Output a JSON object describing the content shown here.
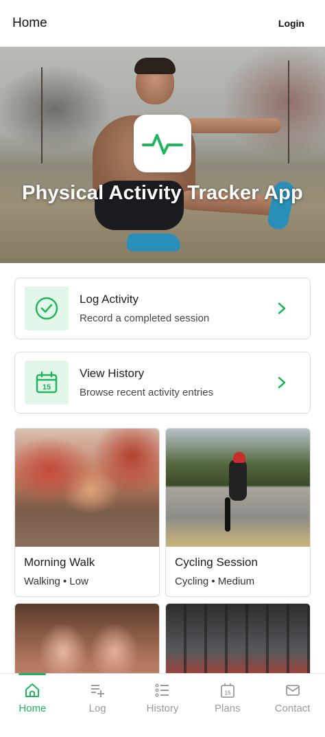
{
  "header": {
    "title": "Home",
    "login_label": "Login"
  },
  "hero": {
    "title": "Physical Activity Tracker App",
    "logo_icon": "pulse-icon"
  },
  "actions": [
    {
      "title": "Log Activity",
      "subtitle": "Record a completed session",
      "icon": "check-circle-icon"
    },
    {
      "title": "View History",
      "subtitle": "Browse recent activity entries",
      "icon": "calendar-icon",
      "calendar_day": "15"
    }
  ],
  "activities": [
    {
      "name": "Morning Walk",
      "meta": "Walking • Low"
    },
    {
      "name": "Cycling Session",
      "meta": "Cycling • Medium"
    }
  ],
  "nav": {
    "items": [
      {
        "label": "Home",
        "icon": "home-icon",
        "active": true
      },
      {
        "label": "Log",
        "icon": "list-add-icon",
        "active": false
      },
      {
        "label": "History",
        "icon": "list-icon",
        "active": false
      },
      {
        "label": "Plans",
        "icon": "calendar-icon",
        "active": false
      },
      {
        "label": "Contact",
        "icon": "mail-icon",
        "active": false
      }
    ],
    "plans_calendar_day": "15"
  },
  "colors": {
    "accent": "#1fb55d",
    "accent_light": "#e3f6ea",
    "inactive": "#9a9a9a"
  }
}
